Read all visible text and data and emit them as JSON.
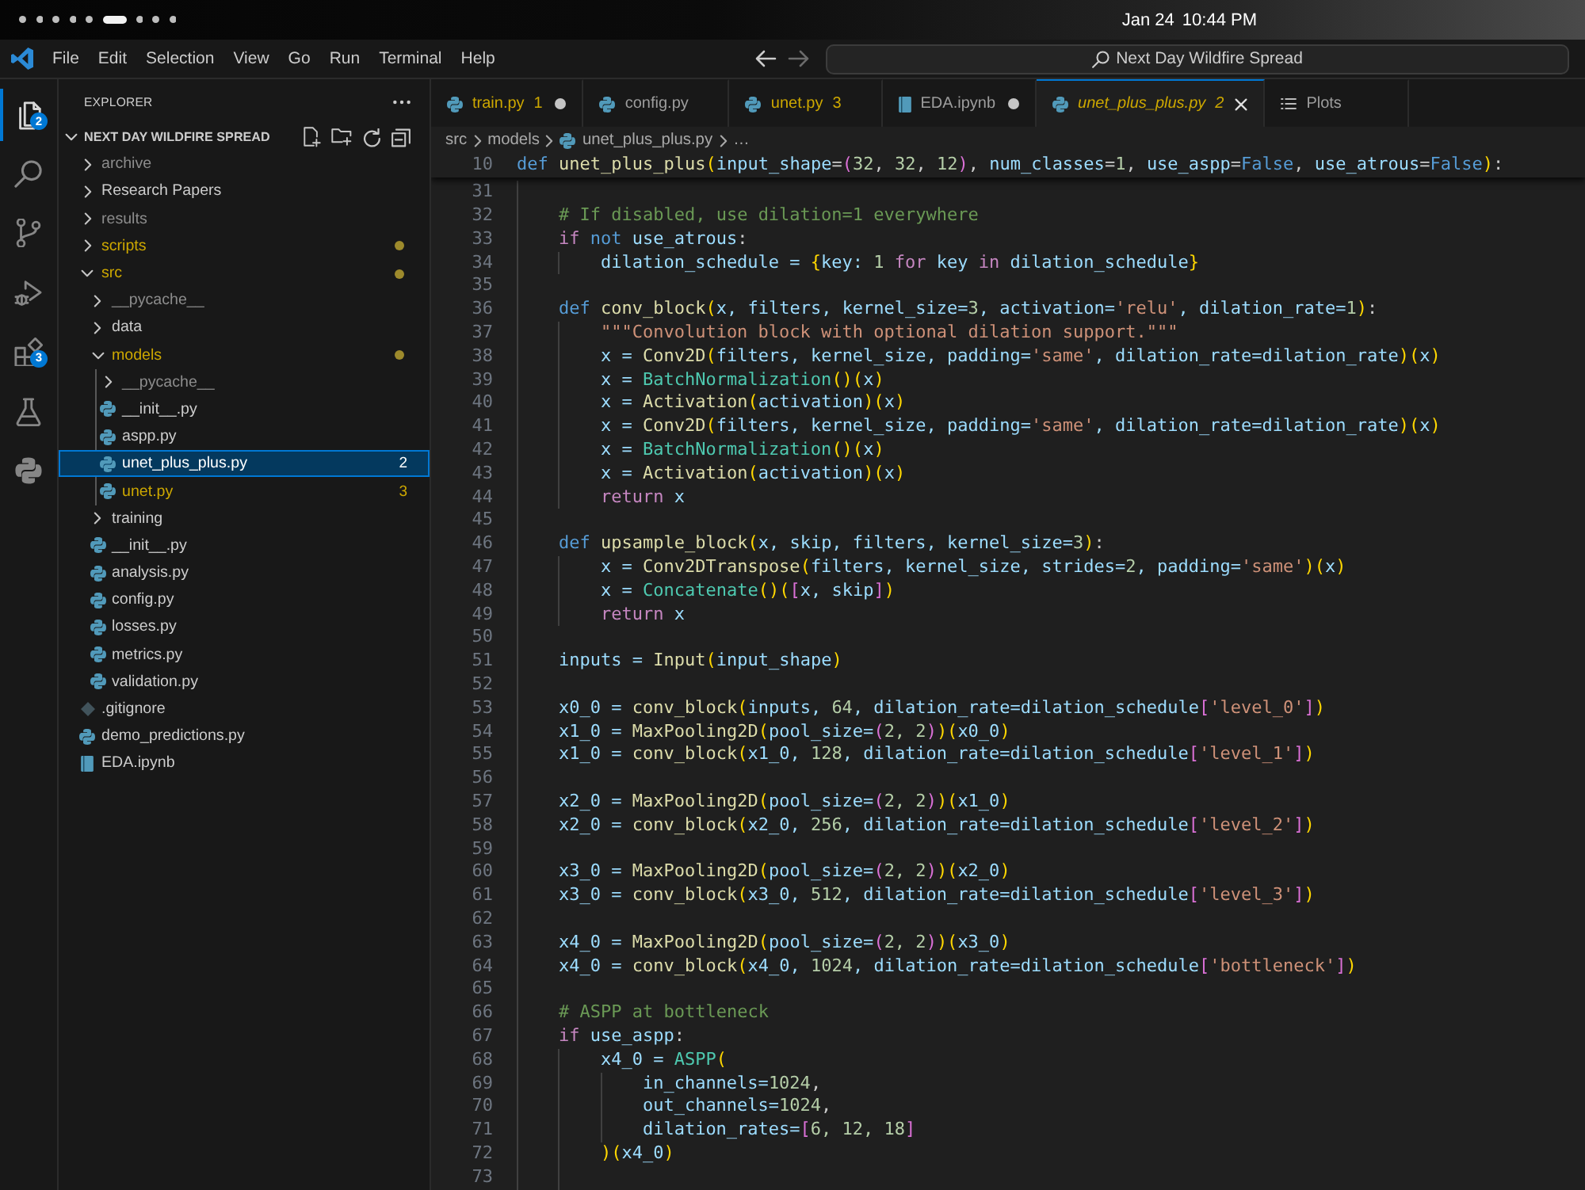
{
  "system_bar": {
    "workspaces": [
      {
        "selected": false
      },
      {
        "selected": false
      },
      {
        "selected": false
      },
      {
        "selected": false
      },
      {
        "selected": false
      },
      {
        "selected": true
      },
      {
        "selected": false
      },
      {
        "selected": false
      },
      {
        "selected": false
      }
    ],
    "date": "Jan 24",
    "time": "10:44 PM"
  },
  "title_bar": {
    "menu": [
      "File",
      "Edit",
      "Selection",
      "View",
      "Go",
      "Run",
      "Terminal",
      "Help"
    ],
    "navigation": [
      {
        "kind": "back",
        "disabled": false
      },
      {
        "kind": "forward",
        "disabled": true
      }
    ],
    "command_center": {
      "text": "Next Day Wildfire Spread"
    }
  },
  "activity_bar": [
    {
      "kind": "explorer",
      "selected": true,
      "badge": "2"
    },
    {
      "kind": "search",
      "selected": false
    },
    {
      "kind": "source_control",
      "selected": false
    },
    {
      "kind": "run_debug",
      "selected": false
    },
    {
      "kind": "extensions",
      "selected": false,
      "badge": "3"
    },
    {
      "kind": "testing",
      "selected": false
    },
    {
      "kind": "python",
      "selected": false
    }
  ],
  "sidebar": {
    "title": "EXPLORER",
    "section": {
      "title": "NEXT DAY WILDFIRE SPREAD",
      "expanded": true
    },
    "tree": [
      {
        "label": "archive",
        "kind": "folder",
        "expanded": false,
        "selected": false,
        "ignored": true,
        "warning": false
      },
      {
        "label": "Research Papers",
        "kind": "folder",
        "expanded": false,
        "selected": false,
        "ignored": false,
        "warning": false
      },
      {
        "label": "results",
        "kind": "folder",
        "expanded": false,
        "selected": false,
        "ignored": true,
        "warning": false
      },
      {
        "label": "scripts",
        "kind": "folder",
        "expanded": false,
        "selected": false,
        "ignored": false,
        "warning": true
      },
      {
        "label": "src",
        "kind": "folder",
        "expanded": true,
        "selected": false,
        "ignored": false,
        "warning": true,
        "children": [
          {
            "label": "__pycache__",
            "kind": "folder",
            "expanded": false,
            "selected": false,
            "ignored": true,
            "warning": false
          },
          {
            "label": "data",
            "kind": "folder",
            "expanded": false,
            "selected": false,
            "ignored": false,
            "warning": false
          },
          {
            "label": "models",
            "kind": "folder",
            "expanded": true,
            "selected": false,
            "ignored": false,
            "warning": true,
            "children": [
              {
                "label": "__pycache__",
                "kind": "folder",
                "expanded": false,
                "selected": false,
                "ignored": true,
                "warning": false
              },
              {
                "label": "__init__.py",
                "kind": "python",
                "selected": false,
                "ignored": false,
                "warning": false
              },
              {
                "label": "aspp.py",
                "kind": "python",
                "selected": false,
                "ignored": false,
                "warning": false
              },
              {
                "label": "unet_plus_plus.py",
                "kind": "python",
                "selected": true,
                "ignored": false,
                "warning": false,
                "problems": "2"
              },
              {
                "label": "unet.py",
                "kind": "python",
                "selected": false,
                "ignored": false,
                "warning": true,
                "problems": "3"
              }
            ]
          },
          {
            "label": "training",
            "kind": "folder",
            "expanded": false,
            "selected": false,
            "ignored": false,
            "warning": false
          },
          {
            "label": "__init__.py",
            "kind": "python",
            "selected": false,
            "ignored": false,
            "warning": false
          },
          {
            "label": "analysis.py",
            "kind": "python",
            "selected": false,
            "ignored": false,
            "warning": false
          },
          {
            "label": "config.py",
            "kind": "python",
            "selected": false,
            "ignored": false,
            "warning": false
          },
          {
            "label": "losses.py",
            "kind": "python",
            "selected": false,
            "ignored": false,
            "warning": false
          },
          {
            "label": "metrics.py",
            "kind": "python",
            "selected": false,
            "ignored": false,
            "warning": false
          },
          {
            "label": "validation.py",
            "kind": "python",
            "selected": false,
            "ignored": false,
            "warning": false
          }
        ]
      },
      {
        "label": ".gitignore",
        "kind": "gitignore",
        "selected": false,
        "ignored": false,
        "warning": false
      },
      {
        "label": "demo_predictions.py",
        "kind": "python",
        "selected": false,
        "ignored": false,
        "warning": false
      },
      {
        "label": "EDA.ipynb",
        "kind": "notebook",
        "selected": false,
        "ignored": false,
        "warning": false
      }
    ]
  },
  "tabs": [
    {
      "label": "train.py",
      "kind": "python",
      "selected": false,
      "preview": false,
      "modified": true,
      "warning": true,
      "problems": "1"
    },
    {
      "label": "config.py",
      "kind": "python",
      "selected": false,
      "preview": false,
      "modified": false,
      "warning": false
    },
    {
      "label": "unet.py",
      "kind": "python",
      "selected": false,
      "preview": false,
      "modified": false,
      "warning": true,
      "problems": "3"
    },
    {
      "label": "EDA.ipynb",
      "kind": "notebook",
      "selected": false,
      "preview": false,
      "modified": true,
      "warning": false
    },
    {
      "label": "unet_plus_plus.py",
      "kind": "python",
      "selected": true,
      "preview": true,
      "modified": false,
      "warning": true,
      "problems": "2"
    },
    {
      "label": "Plots",
      "kind": "plots",
      "selected": false,
      "preview": false,
      "modified": false,
      "warning": false
    }
  ],
  "breadcrumb": [
    {
      "label": "src",
      "kind": "folder"
    },
    {
      "label": "models",
      "kind": "folder"
    },
    {
      "label": "unet_plus_plus.py",
      "kind": "python"
    },
    {
      "label": "…",
      "kind": "more"
    }
  ],
  "editor": {
    "sticky_line": {
      "number": "10",
      "tokens": [
        {
          "kind": "keyword",
          "text": "def "
        },
        {
          "kind": "function",
          "text": "unet_plus_plus"
        },
        {
          "kind": "bracket1",
          "text": "("
        },
        {
          "kind": "variable",
          "text": "input_shape"
        },
        {
          "kind": "operator",
          "text": "="
        },
        {
          "kind": "bracket2",
          "text": "("
        },
        {
          "kind": "number",
          "text": "32"
        },
        {
          "kind": "operator",
          "text": ", "
        },
        {
          "kind": "number",
          "text": "32"
        },
        {
          "kind": "operator",
          "text": ", "
        },
        {
          "kind": "number",
          "text": "12"
        },
        {
          "kind": "bracket2",
          "text": ")"
        },
        {
          "kind": "operator",
          "text": ", "
        },
        {
          "kind": "variable",
          "text": "num_classes"
        },
        {
          "kind": "operator",
          "text": "="
        },
        {
          "kind": "number",
          "text": "1"
        },
        {
          "kind": "operator",
          "text": ", "
        },
        {
          "kind": "variable",
          "text": "use_aspp"
        },
        {
          "kind": "operator",
          "text": "="
        },
        {
          "kind": "keyword",
          "text": "False"
        },
        {
          "kind": "operator",
          "text": ", "
        },
        {
          "kind": "variable",
          "text": "use_atrous"
        },
        {
          "kind": "operator",
          "text": "="
        },
        {
          "kind": "keyword",
          "text": "False"
        },
        {
          "kind": "bracket1",
          "text": ")"
        },
        {
          "kind": "operator",
          "text": ":"
        }
      ]
    },
    "lines": [
      {
        "number": "31"
      },
      {
        "number": "32",
        "tokens": [
          {
            "kind": "comment",
            "text": "    # If disabled, use dilation=1 everywhere"
          }
        ]
      },
      {
        "number": "33",
        "tokens": [
          {
            "kind": "control",
            "text": "    if "
          },
          {
            "kind": "keyword",
            "text": "not "
          },
          {
            "kind": "variable",
            "text": "use_atrous"
          },
          {
            "kind": "operator",
            "text": ":"
          }
        ]
      },
      {
        "number": "34",
        "tokens": [
          {
            "kind": "variable",
            "text": "        dilation_schedule = "
          },
          {
            "kind": "bracket1",
            "text": "{"
          },
          {
            "kind": "variable",
            "text": "key: "
          },
          {
            "kind": "number",
            "text": "1 "
          },
          {
            "kind": "control",
            "text": "for "
          },
          {
            "kind": "variable",
            "text": "key "
          },
          {
            "kind": "control",
            "text": "in "
          },
          {
            "kind": "variable",
            "text": "dilation_schedule"
          },
          {
            "kind": "bracket1",
            "text": "}"
          }
        ]
      },
      {
        "number": "35"
      },
      {
        "number": "36",
        "tokens": [
          {
            "kind": "keyword",
            "text": "    def "
          },
          {
            "kind": "function",
            "text": "conv_block"
          },
          {
            "kind": "bracket1",
            "text": "("
          },
          {
            "kind": "variable",
            "text": "x, filters, kernel_size="
          },
          {
            "kind": "number",
            "text": "3"
          },
          {
            "kind": "variable",
            "text": ", activation="
          },
          {
            "kind": "string",
            "text": "'relu'"
          },
          {
            "kind": "variable",
            "text": ", dilation_rate="
          },
          {
            "kind": "number",
            "text": "1"
          },
          {
            "kind": "bracket1",
            "text": ")"
          },
          {
            "kind": "operator",
            "text": ":"
          }
        ]
      },
      {
        "number": "37",
        "tokens": [
          {
            "kind": "string",
            "text": "        \"\"\"Convolution block with optional dilation support.\"\"\""
          }
        ]
      },
      {
        "number": "38",
        "tokens": [
          {
            "kind": "variable",
            "text": "        x = "
          },
          {
            "kind": "function",
            "text": "Conv2D"
          },
          {
            "kind": "bracket1",
            "text": "("
          },
          {
            "kind": "variable",
            "text": "filters, kernel_size, padding="
          },
          {
            "kind": "string",
            "text": "'same'"
          },
          {
            "kind": "variable",
            "text": ", dilation_rate=dilation_rate"
          },
          {
            "kind": "bracket1",
            "text": ")("
          },
          {
            "kind": "variable",
            "text": "x"
          },
          {
            "kind": "bracket1",
            "text": ")"
          }
        ]
      },
      {
        "number": "39",
        "tokens": [
          {
            "kind": "variable",
            "text": "        x = "
          },
          {
            "kind": "class",
            "text": "BatchNormalization"
          },
          {
            "kind": "bracket1",
            "text": "()("
          },
          {
            "kind": "variable",
            "text": "x"
          },
          {
            "kind": "bracket1",
            "text": ")"
          }
        ]
      },
      {
        "number": "40",
        "tokens": [
          {
            "kind": "variable",
            "text": "        x = "
          },
          {
            "kind": "function",
            "text": "Activation"
          },
          {
            "kind": "bracket1",
            "text": "("
          },
          {
            "kind": "variable",
            "text": "activation"
          },
          {
            "kind": "bracket1",
            "text": ")("
          },
          {
            "kind": "variable",
            "text": "x"
          },
          {
            "kind": "bracket1",
            "text": ")"
          }
        ]
      },
      {
        "number": "41",
        "tokens": [
          {
            "kind": "variable",
            "text": "        x = "
          },
          {
            "kind": "function",
            "text": "Conv2D"
          },
          {
            "kind": "bracket1",
            "text": "("
          },
          {
            "kind": "variable",
            "text": "filters, kernel_size, padding="
          },
          {
            "kind": "string",
            "text": "'same'"
          },
          {
            "kind": "variable",
            "text": ", dilation_rate=dilation_rate"
          },
          {
            "kind": "bracket1",
            "text": ")("
          },
          {
            "kind": "variable",
            "text": "x"
          },
          {
            "kind": "bracket1",
            "text": ")"
          }
        ]
      },
      {
        "number": "42",
        "tokens": [
          {
            "kind": "variable",
            "text": "        x = "
          },
          {
            "kind": "class",
            "text": "BatchNormalization"
          },
          {
            "kind": "bracket1",
            "text": "()("
          },
          {
            "kind": "variable",
            "text": "x"
          },
          {
            "kind": "bracket1",
            "text": ")"
          }
        ]
      },
      {
        "number": "43",
        "tokens": [
          {
            "kind": "variable",
            "text": "        x = "
          },
          {
            "kind": "function",
            "text": "Activation"
          },
          {
            "kind": "bracket1",
            "text": "("
          },
          {
            "kind": "variable",
            "text": "activation"
          },
          {
            "kind": "bracket1",
            "text": ")("
          },
          {
            "kind": "variable",
            "text": "x"
          },
          {
            "kind": "bracket1",
            "text": ")"
          }
        ]
      },
      {
        "number": "44",
        "tokens": [
          {
            "kind": "control",
            "text": "        return "
          },
          {
            "kind": "variable",
            "text": "x"
          }
        ]
      },
      {
        "number": "45"
      },
      {
        "number": "46",
        "tokens": [
          {
            "kind": "keyword",
            "text": "    def "
          },
          {
            "kind": "function",
            "text": "upsample_block"
          },
          {
            "kind": "bracket1",
            "text": "("
          },
          {
            "kind": "variable",
            "text": "x, skip, filters, kernel_size="
          },
          {
            "kind": "number",
            "text": "3"
          },
          {
            "kind": "bracket1",
            "text": ")"
          },
          {
            "kind": "operator",
            "text": ":"
          }
        ]
      },
      {
        "number": "47",
        "tokens": [
          {
            "kind": "variable",
            "text": "        x = "
          },
          {
            "kind": "function",
            "text": "Conv2DTranspose"
          },
          {
            "kind": "bracket1",
            "text": "("
          },
          {
            "kind": "variable",
            "text": "filters, kernel_size, strides="
          },
          {
            "kind": "number",
            "text": "2"
          },
          {
            "kind": "variable",
            "text": ", padding="
          },
          {
            "kind": "string",
            "text": "'same'"
          },
          {
            "kind": "bracket1",
            "text": ")("
          },
          {
            "kind": "variable",
            "text": "x"
          },
          {
            "kind": "bracket1",
            "text": ")"
          }
        ]
      },
      {
        "number": "48",
        "tokens": [
          {
            "kind": "variable",
            "text": "        x = "
          },
          {
            "kind": "class",
            "text": "Concatenate"
          },
          {
            "kind": "bracket1",
            "text": "()("
          },
          {
            "kind": "bracket2",
            "text": "["
          },
          {
            "kind": "variable",
            "text": "x, skip"
          },
          {
            "kind": "bracket2",
            "text": "]"
          },
          {
            "kind": "bracket1",
            "text": ")"
          }
        ]
      },
      {
        "number": "49",
        "tokens": [
          {
            "kind": "control",
            "text": "        return "
          },
          {
            "kind": "variable",
            "text": "x"
          }
        ]
      },
      {
        "number": "50"
      },
      {
        "number": "51",
        "tokens": [
          {
            "kind": "variable",
            "text": "    inputs = "
          },
          {
            "kind": "function",
            "text": "Input"
          },
          {
            "kind": "bracket1",
            "text": "("
          },
          {
            "kind": "variable",
            "text": "input_shape"
          },
          {
            "kind": "bracket1",
            "text": ")"
          }
        ]
      },
      {
        "number": "52"
      },
      {
        "number": "53",
        "tokens": [
          {
            "kind": "variable",
            "text": "    x0_0 = "
          },
          {
            "kind": "function",
            "text": "conv_block"
          },
          {
            "kind": "bracket1",
            "text": "("
          },
          {
            "kind": "variable",
            "text": "inputs, "
          },
          {
            "kind": "number",
            "text": "64"
          },
          {
            "kind": "variable",
            "text": ", dilation_rate=dilation_schedule"
          },
          {
            "kind": "bracket2",
            "text": "["
          },
          {
            "kind": "string",
            "text": "'level_0'"
          },
          {
            "kind": "bracket2",
            "text": "]"
          },
          {
            "kind": "bracket1",
            "text": ")"
          }
        ]
      },
      {
        "number": "54",
        "tokens": [
          {
            "kind": "variable",
            "text": "    x1_0 = "
          },
          {
            "kind": "function",
            "text": "MaxPooling2D"
          },
          {
            "kind": "bracket1",
            "text": "("
          },
          {
            "kind": "variable",
            "text": "pool_size="
          },
          {
            "kind": "bracket2",
            "text": "("
          },
          {
            "kind": "number",
            "text": "2, 2"
          },
          {
            "kind": "bracket2",
            "text": ")"
          },
          {
            "kind": "bracket1",
            "text": ")("
          },
          {
            "kind": "variable",
            "text": "x0_0"
          },
          {
            "kind": "bracket1",
            "text": ")"
          }
        ]
      },
      {
        "number": "55",
        "tokens": [
          {
            "kind": "variable",
            "text": "    x1_0 = "
          },
          {
            "kind": "function",
            "text": "conv_block"
          },
          {
            "kind": "bracket1",
            "text": "("
          },
          {
            "kind": "variable",
            "text": "x1_0, "
          },
          {
            "kind": "number",
            "text": "128"
          },
          {
            "kind": "variable",
            "text": ", dilation_rate=dilation_schedule"
          },
          {
            "kind": "bracket2",
            "text": "["
          },
          {
            "kind": "string",
            "text": "'level_1'"
          },
          {
            "kind": "bracket2",
            "text": "]"
          },
          {
            "kind": "bracket1",
            "text": ")"
          }
        ]
      },
      {
        "number": "56"
      },
      {
        "number": "57",
        "tokens": [
          {
            "kind": "variable",
            "text": "    x2_0 = "
          },
          {
            "kind": "function",
            "text": "MaxPooling2D"
          },
          {
            "kind": "bracket1",
            "text": "("
          },
          {
            "kind": "variable",
            "text": "pool_size="
          },
          {
            "kind": "bracket2",
            "text": "("
          },
          {
            "kind": "number",
            "text": "2, 2"
          },
          {
            "kind": "bracket2",
            "text": ")"
          },
          {
            "kind": "bracket1",
            "text": ")("
          },
          {
            "kind": "variable",
            "text": "x1_0"
          },
          {
            "kind": "bracket1",
            "text": ")"
          }
        ]
      },
      {
        "number": "58",
        "tokens": [
          {
            "kind": "variable",
            "text": "    x2_0 = "
          },
          {
            "kind": "function",
            "text": "conv_block"
          },
          {
            "kind": "bracket1",
            "text": "("
          },
          {
            "kind": "variable",
            "text": "x2_0, "
          },
          {
            "kind": "number",
            "text": "256"
          },
          {
            "kind": "variable",
            "text": ", dilation_rate=dilation_schedule"
          },
          {
            "kind": "bracket2",
            "text": "["
          },
          {
            "kind": "string",
            "text": "'level_2'"
          },
          {
            "kind": "bracket2",
            "text": "]"
          },
          {
            "kind": "bracket1",
            "text": ")"
          }
        ]
      },
      {
        "number": "59"
      },
      {
        "number": "60",
        "tokens": [
          {
            "kind": "variable",
            "text": "    x3_0 = "
          },
          {
            "kind": "function",
            "text": "MaxPooling2D"
          },
          {
            "kind": "bracket1",
            "text": "("
          },
          {
            "kind": "variable",
            "text": "pool_size="
          },
          {
            "kind": "bracket2",
            "text": "("
          },
          {
            "kind": "number",
            "text": "2, 2"
          },
          {
            "kind": "bracket2",
            "text": ")"
          },
          {
            "kind": "bracket1",
            "text": ")("
          },
          {
            "kind": "variable",
            "text": "x2_0"
          },
          {
            "kind": "bracket1",
            "text": ")"
          }
        ]
      },
      {
        "number": "61",
        "tokens": [
          {
            "kind": "variable",
            "text": "    x3_0 = "
          },
          {
            "kind": "function",
            "text": "conv_block"
          },
          {
            "kind": "bracket1",
            "text": "("
          },
          {
            "kind": "variable",
            "text": "x3_0, "
          },
          {
            "kind": "number",
            "text": "512"
          },
          {
            "kind": "variable",
            "text": ", dilation_rate=dilation_schedule"
          },
          {
            "kind": "bracket2",
            "text": "["
          },
          {
            "kind": "string",
            "text": "'level_3'"
          },
          {
            "kind": "bracket2",
            "text": "]"
          },
          {
            "kind": "bracket1",
            "text": ")"
          }
        ]
      },
      {
        "number": "62"
      },
      {
        "number": "63",
        "tokens": [
          {
            "kind": "variable",
            "text": "    x4_0 = "
          },
          {
            "kind": "function",
            "text": "MaxPooling2D"
          },
          {
            "kind": "bracket1",
            "text": "("
          },
          {
            "kind": "variable",
            "text": "pool_size="
          },
          {
            "kind": "bracket2",
            "text": "("
          },
          {
            "kind": "number",
            "text": "2, 2"
          },
          {
            "kind": "bracket2",
            "text": ")"
          },
          {
            "kind": "bracket1",
            "text": ")("
          },
          {
            "kind": "variable",
            "text": "x3_0"
          },
          {
            "kind": "bracket1",
            "text": ")"
          }
        ]
      },
      {
        "number": "64",
        "tokens": [
          {
            "kind": "variable",
            "text": "    x4_0 = "
          },
          {
            "kind": "function",
            "text": "conv_block"
          },
          {
            "kind": "bracket1",
            "text": "("
          },
          {
            "kind": "variable",
            "text": "x4_0, "
          },
          {
            "kind": "number",
            "text": "1024"
          },
          {
            "kind": "variable",
            "text": ", dilation_rate=dilation_schedule"
          },
          {
            "kind": "bracket2",
            "text": "["
          },
          {
            "kind": "string",
            "text": "'bottleneck'"
          },
          {
            "kind": "bracket2",
            "text": "]"
          },
          {
            "kind": "bracket1",
            "text": ")"
          }
        ]
      },
      {
        "number": "65"
      },
      {
        "number": "66",
        "tokens": [
          {
            "kind": "comment",
            "text": "    # ASPP at bottleneck"
          }
        ]
      },
      {
        "number": "67",
        "tokens": [
          {
            "kind": "control",
            "text": "    if "
          },
          {
            "kind": "variable",
            "text": "use_aspp"
          },
          {
            "kind": "operator",
            "text": ":"
          }
        ]
      },
      {
        "number": "68",
        "tokens": [
          {
            "kind": "variable",
            "text": "        x4_0 = "
          },
          {
            "kind": "class",
            "text": "ASPP"
          },
          {
            "kind": "bracket1",
            "text": "("
          }
        ]
      },
      {
        "number": "69",
        "tokens": [
          {
            "kind": "variable",
            "text": "            in_channels="
          },
          {
            "kind": "number",
            "text": "1024"
          },
          {
            "kind": "operator",
            "text": ","
          }
        ]
      },
      {
        "number": "70",
        "tokens": [
          {
            "kind": "variable",
            "text": "            out_channels="
          },
          {
            "kind": "number",
            "text": "1024"
          },
          {
            "kind": "operator",
            "text": ","
          }
        ]
      },
      {
        "number": "71",
        "tokens": [
          {
            "kind": "variable",
            "text": "            dilation_rates="
          },
          {
            "kind": "bracket2",
            "text": "["
          },
          {
            "kind": "number",
            "text": "6, 12, 18"
          },
          {
            "kind": "bracket2",
            "text": "]"
          }
        ]
      },
      {
        "number": "72",
        "tokens": [
          {
            "kind": "bracket1",
            "text": "        )("
          },
          {
            "kind": "variable",
            "text": "x4_0"
          },
          {
            "kind": "bracket1",
            "text": ")"
          }
        ]
      },
      {
        "number": "73"
      }
    ]
  }
}
